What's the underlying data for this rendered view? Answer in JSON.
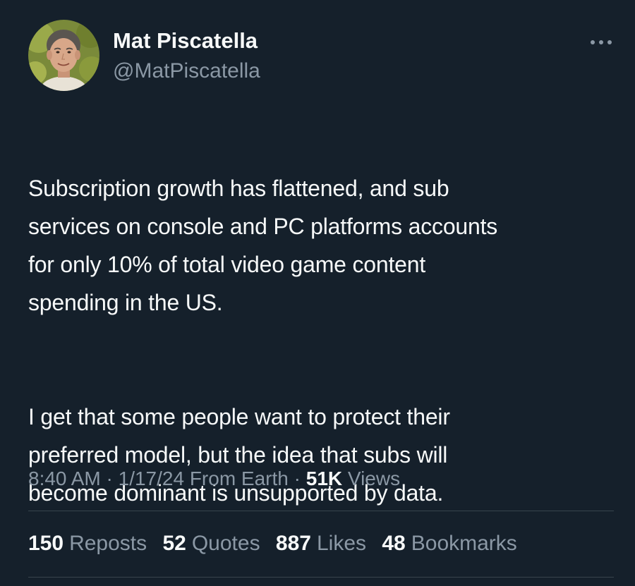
{
  "author": {
    "display_name": "Mat Piscatella",
    "handle": "@MatPiscatella"
  },
  "tweet": {
    "paragraphs": [
      "Subscription growth has flattened, and sub\nservices on console and PC platforms accounts\nfor only 10% of total video game content\nspending in the US.",
      "I get that some people want to protect their\npreferred model, but the idea that subs will\nbecome dominant is unsupported by data."
    ]
  },
  "meta": {
    "time": "8:40 AM",
    "sep1": " · ",
    "date": "1/17/24",
    "source": " From Earth",
    "sep2": " · ",
    "views_count": "51K",
    "views_label": " Views"
  },
  "stats": {
    "reposts": {
      "count": "150",
      "label": "Reposts"
    },
    "quotes": {
      "count": "52",
      "label": "Quotes"
    },
    "likes": {
      "count": "887",
      "label": "Likes"
    },
    "bookmarks": {
      "count": "48",
      "label": "Bookmarks"
    }
  },
  "icons": {
    "more": "more-horizontal-icon"
  },
  "colors": {
    "background": "#15202b",
    "primary_text": "#f7f9f9",
    "secondary_text": "#8b98a5",
    "divider": "#38444d"
  }
}
